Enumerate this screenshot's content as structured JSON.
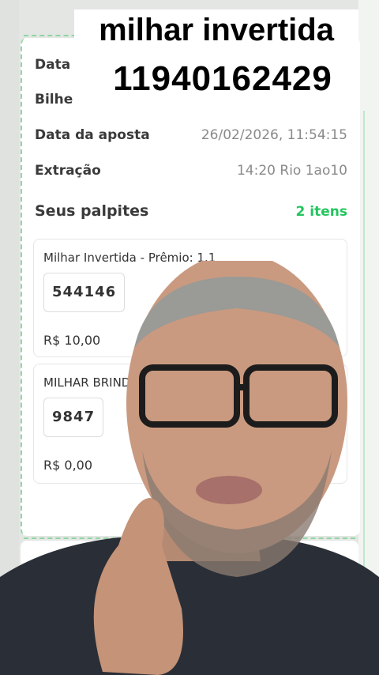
{
  "overlay": {
    "line1": "milhar invertida",
    "line2": "11940162429"
  },
  "ticket": {
    "rows": [
      {
        "label": "Data",
        "value": ""
      },
      {
        "label": "Bilhe",
        "value": ""
      },
      {
        "label": "Data da aposta",
        "value": "26/02/2026, 11:54:15"
      },
      {
        "label": "Extração",
        "value": "14:20 Rio 1ao10"
      }
    ],
    "section_title": "Seus palpites",
    "count": "2 itens",
    "items": [
      {
        "title": "Milhar Invertida - Prêmio: 1.1",
        "number": "544146",
        "price": "R$ 10,00"
      },
      {
        "title": "MILHAR BRIND",
        "number": "9847",
        "price": "R$ 0,00"
      }
    ]
  },
  "colors": {
    "accent": "#22c55e",
    "dashed": "#8fd7a2"
  }
}
